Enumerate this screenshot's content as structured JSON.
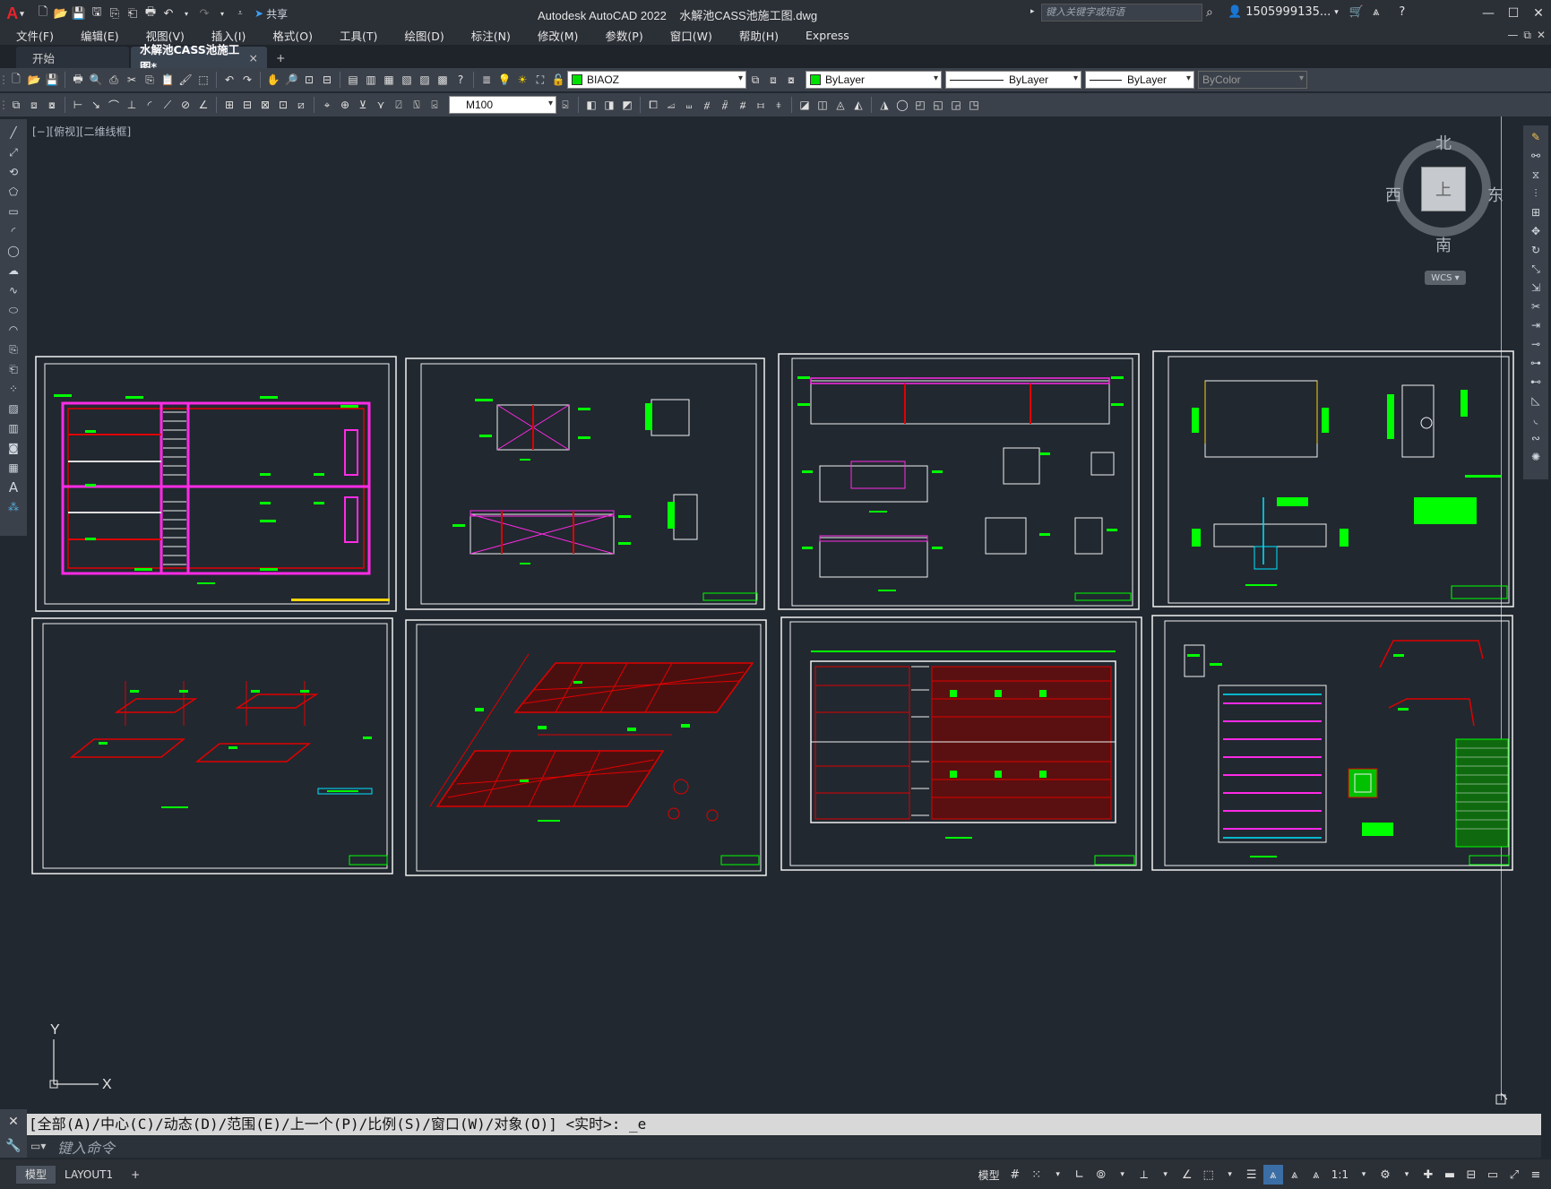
{
  "title": {
    "app": "Autodesk AutoCAD 2022",
    "file": "水解池CASS池施工图.dwg",
    "share": "共享",
    "search_placeholder": "键入关键字或短语",
    "user": "1505999135..."
  },
  "menu": [
    "文件(F)",
    "编辑(E)",
    "视图(V)",
    "插入(I)",
    "格式(O)",
    "工具(T)",
    "绘图(D)",
    "标注(N)",
    "修改(M)",
    "参数(P)",
    "窗口(W)",
    "帮助(H)",
    "Express"
  ],
  "tabs": {
    "start": "开始",
    "drawing": "水解池CASS池施工图*",
    "close": "×",
    "new": "+"
  },
  "toolbar": {
    "layer": "BIAOZ",
    "color": "ByLayer",
    "linetype": "ByLayer",
    "lineweight": "ByLayer",
    "plotstyle": "ByColor",
    "dimstyle": "M100",
    "colors": {
      "layer_swatch": "#00e000",
      "color_swatch": "#00e000"
    }
  },
  "viewport": {
    "label": "[−][俯视][二维线框]",
    "viewcube": {
      "north": "北",
      "south": "南",
      "east": "东",
      "west": "西",
      "face": "上"
    },
    "wcs": "WCS ▾",
    "ucs": {
      "y": "Y",
      "x": "X"
    },
    "sheet_count": 8
  },
  "command": {
    "history": "[全部(A)/中心(C)/动态(D)/范围(E)/上一个(P)/比例(S)/窗口(W)/对象(O)] <实时>: _e",
    "placeholder": "键入命令"
  },
  "status": {
    "model_tab": "模型",
    "layout_tab": "LAYOUT1",
    "add": "+",
    "model_label": "模型",
    "scale": "1:1"
  }
}
